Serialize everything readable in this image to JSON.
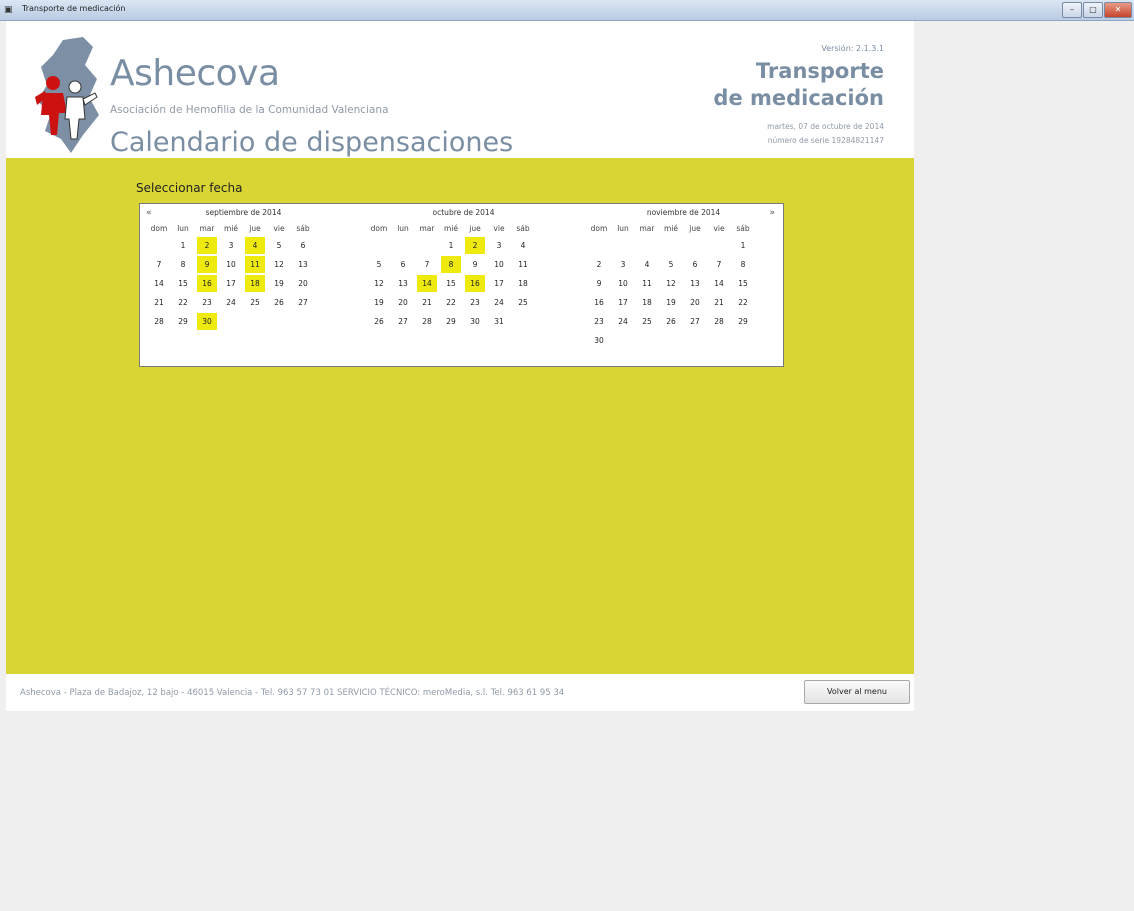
{
  "window": {
    "title": "Transporte de medicación"
  },
  "header": {
    "brand": "Ashecova",
    "subtitle": "Asociación de Hemofilia de la Comunidad Valenciana",
    "page_title": "Calendario de dispensaciones",
    "version": "Versión: 2.1.3.1",
    "app_title_line1": "Transporte",
    "app_title_line2": "de medicación",
    "date": "martes, 07 de octubre de 2014",
    "serial": "número de serie 19284821147"
  },
  "content": {
    "select_label": "Seleccionar fecha"
  },
  "calendar": {
    "highlight_color": "#eeea10",
    "weekdays": [
      "dom",
      "lun",
      "mar",
      "mié",
      "jue",
      "vie",
      "sáb"
    ],
    "months": [
      {
        "title": "septiembre de 2014",
        "weeks": [
          [
            "",
            "1",
            "2",
            "3",
            "4",
            "5",
            "6"
          ],
          [
            "7",
            "8",
            "9",
            "10",
            "11",
            "12",
            "13"
          ],
          [
            "14",
            "15",
            "16",
            "17",
            "18",
            "19",
            "20"
          ],
          [
            "21",
            "22",
            "23",
            "24",
            "25",
            "26",
            "27"
          ],
          [
            "28",
            "29",
            "30",
            "",
            "",
            "",
            ""
          ]
        ],
        "highlighted": [
          "2",
          "4",
          "9",
          "11",
          "16",
          "18",
          "30"
        ]
      },
      {
        "title": "octubre de 2014",
        "weeks": [
          [
            "",
            "",
            "",
            "1",
            "2",
            "3",
            "4"
          ],
          [
            "5",
            "6",
            "7",
            "8",
            "9",
            "10",
            "11"
          ],
          [
            "12",
            "13",
            "14",
            "15",
            "16",
            "17",
            "18"
          ],
          [
            "19",
            "20",
            "21",
            "22",
            "23",
            "24",
            "25"
          ],
          [
            "26",
            "27",
            "28",
            "29",
            "30",
            "31",
            ""
          ]
        ],
        "highlighted": [
          "2",
          "8",
          "14",
          "16"
        ]
      },
      {
        "title": "noviembre de 2014",
        "weeks": [
          [
            "",
            "",
            "",
            "",
            "",
            "",
            "1"
          ],
          [
            "2",
            "3",
            "4",
            "5",
            "6",
            "7",
            "8"
          ],
          [
            "9",
            "10",
            "11",
            "12",
            "13",
            "14",
            "15"
          ],
          [
            "16",
            "17",
            "18",
            "19",
            "20",
            "21",
            "22"
          ],
          [
            "23",
            "24",
            "25",
            "26",
            "27",
            "28",
            "29"
          ],
          [
            "30",
            "",
            "",
            "",
            "",
            "",
            ""
          ]
        ],
        "highlighted": []
      }
    ],
    "prev_icon": "«",
    "next_icon": "»"
  },
  "footer": {
    "text": "Ashecova - Plaza de Badajoz, 12 bajo - 46015 Valencia - Tel. 963 57 73 01     SERVICIO TÉCNICO: meroMedia, s.l. Tel. 963 61 95 34",
    "back_button": "Volver al menu"
  }
}
